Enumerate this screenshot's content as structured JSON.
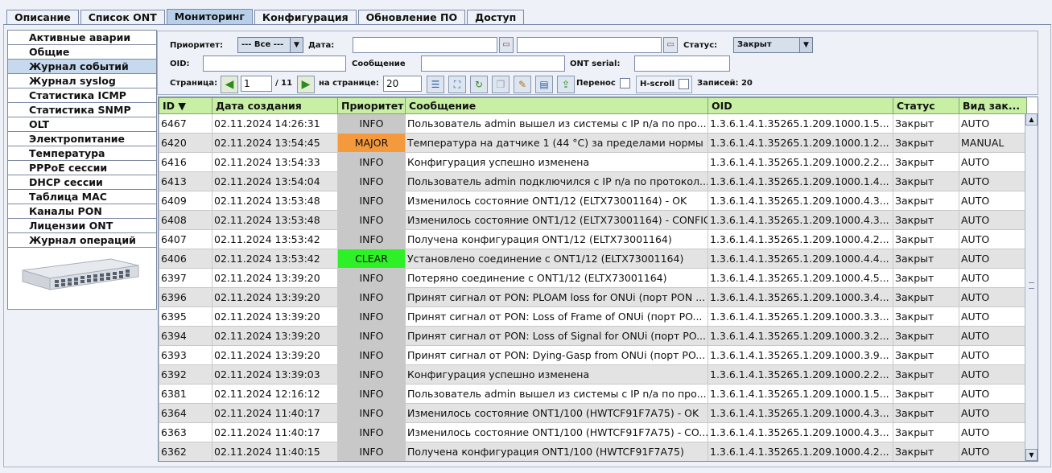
{
  "tabs": [
    "Описание",
    "Список ONT",
    "Мониторинг",
    "Конфигурация",
    "Обновление ПО",
    "Доступ"
  ],
  "sidebar": {
    "items": [
      "Активные аварии",
      "Общие",
      "Журнал событий",
      "Журнал syslog",
      "Статистика ICMP",
      "Статистика SNMP",
      "OLT",
      "Электропитание",
      "Температура",
      "PPPoE сессии",
      "DHCP сессии",
      "Таблица MAC",
      "Каналы PON",
      "Лицензии ONT",
      "Журнал операций"
    ],
    "active": "Журнал событий"
  },
  "filters": {
    "priority_label": "Приоритет:",
    "priority_value": "--- Все ---",
    "date_label": "Дата:",
    "date_from": "",
    "date_to": "",
    "status_label": "Статус:",
    "status_value": "Закрыт",
    "oid_label": "OID:",
    "oid_value": "",
    "message_label": "Сообщение",
    "message_value": "",
    "ont_serial_label": "ONT serial:",
    "ont_serial_value": "",
    "page_label": "Страница:",
    "page_value": "1",
    "page_total": "/ 11",
    "per_page_label": "на странице:",
    "per_page_value": "20",
    "wrap_label": "Перенос",
    "hscroll_label": "H-scroll",
    "records_label": "Записей: 20"
  },
  "table": {
    "headers": [
      "ID ▼",
      "Дата создания",
      "Приоритет",
      "Сообщение",
      "OID",
      "Статус",
      "Вид зак..."
    ],
    "rows": [
      [
        "6467",
        "02.11.2024 14:26:31",
        "INFO",
        "Пользователь admin вышел из системы с IP n/a по про...",
        "1.3.6.1.4.1.35265.1.209.1000.1.5...",
        "Закрыт",
        "AUTO"
      ],
      [
        "6420",
        "02.11.2024 13:54:45",
        "MAJOR",
        "Температура на датчике 1 (44 °C) за пределами нормы",
        "1.3.6.1.4.1.35265.1.209.1000.1.2...",
        "Закрыт",
        "MANUAL"
      ],
      [
        "6416",
        "02.11.2024 13:54:33",
        "INFO",
        "Конфигурация успешно изменена",
        "1.3.6.1.4.1.35265.1.209.1000.2.2...",
        "Закрыт",
        "AUTO"
      ],
      [
        "6413",
        "02.11.2024 13:54:04",
        "INFO",
        "Пользователь admin подключился с IP n/a по протокол...",
        "1.3.6.1.4.1.35265.1.209.1000.1.4...",
        "Закрыт",
        "AUTO"
      ],
      [
        "6409",
        "02.11.2024 13:53:48",
        "INFO",
        "Изменилось состояние ONT1/12 (ELTX73001164) - OK",
        "1.3.6.1.4.1.35265.1.209.1000.4.3...",
        "Закрыт",
        "AUTO"
      ],
      [
        "6408",
        "02.11.2024 13:53:48",
        "INFO",
        "Изменилось состояние ONT1/12 (ELTX73001164) - CONFIG",
        "1.3.6.1.4.1.35265.1.209.1000.4.3...",
        "Закрыт",
        "AUTO"
      ],
      [
        "6407",
        "02.11.2024 13:53:42",
        "INFO",
        "Получена конфигурация ONT1/12 (ELTX73001164)",
        "1.3.6.1.4.1.35265.1.209.1000.4.2...",
        "Закрыт",
        "AUTO"
      ],
      [
        "6406",
        "02.11.2024 13:53:42",
        "CLEAR",
        "Установлено соединение с ONT1/12 (ELTX73001164)",
        "1.3.6.1.4.1.35265.1.209.1000.4.4...",
        "Закрыт",
        "AUTO"
      ],
      [
        "6397",
        "02.11.2024 13:39:20",
        "INFO",
        "Потеряно соединение с ONT1/12 (ELTX73001164)",
        "1.3.6.1.4.1.35265.1.209.1000.4.5...",
        "Закрыт",
        "AUTO"
      ],
      [
        "6396",
        "02.11.2024 13:39:20",
        "INFO",
        "Принят сигнал от PON: PLOAM loss for ONUi (порт PON ...",
        "1.3.6.1.4.1.35265.1.209.1000.3.4...",
        "Закрыт",
        "AUTO"
      ],
      [
        "6395",
        "02.11.2024 13:39:20",
        "INFO",
        "Принят сигнал от PON: Loss of Frame of ONUi (порт PO...",
        "1.3.6.1.4.1.35265.1.209.1000.3.3...",
        "Закрыт",
        "AUTO"
      ],
      [
        "6394",
        "02.11.2024 13:39:20",
        "INFO",
        "Принят сигнал от PON: Loss of Signal for ONUi (порт PO...",
        "1.3.6.1.4.1.35265.1.209.1000.3.2...",
        "Закрыт",
        "AUTO"
      ],
      [
        "6393",
        "02.11.2024 13:39:20",
        "INFO",
        "Принят сигнал от PON: Dying-Gasp from ONUi (порт PO...",
        "1.3.6.1.4.1.35265.1.209.1000.3.9...",
        "Закрыт",
        "AUTO"
      ],
      [
        "6392",
        "02.11.2024 13:39:03",
        "INFO",
        "Конфигурация успешно изменена",
        "1.3.6.1.4.1.35265.1.209.1000.2.2...",
        "Закрыт",
        "AUTO"
      ],
      [
        "6381",
        "02.11.2024 12:16:12",
        "INFO",
        "Пользователь admin вышел из системы с IP n/a по про...",
        "1.3.6.1.4.1.35265.1.209.1000.1.5...",
        "Закрыт",
        "AUTO"
      ],
      [
        "6364",
        "02.11.2024 11:40:17",
        "INFO",
        "Изменилось состояние ONT1/100 (HWTCF91F7A75) - OK",
        "1.3.6.1.4.1.35265.1.209.1000.4.3...",
        "Закрыт",
        "AUTO"
      ],
      [
        "6363",
        "02.11.2024 11:40:17",
        "INFO",
        "Изменилось состояние ONT1/100 (HWTCF91F7A75) - CO...",
        "1.3.6.1.4.1.35265.1.209.1000.4.3...",
        "Закрыт",
        "AUTO"
      ],
      [
        "6362",
        "02.11.2024 11:40:15",
        "INFO",
        "Получена конфигурация ONT1/100 (HWTCF91F7A75)",
        "1.3.6.1.4.1.35265.1.209.1000.4.2...",
        "Закрыт",
        "AUTO"
      ]
    ]
  },
  "colors": {
    "header_bg": "#c7f0a4",
    "info": "#c8c8c8",
    "major": "#f59a3c",
    "clear": "#2ef026",
    "active_tab": "#b8cfe9"
  },
  "icons": [
    "calendar-icon",
    "prev-page-icon",
    "next-page-icon",
    "columns-icon",
    "fit-icon",
    "refresh-icon",
    "copy-icon",
    "clear-filter-icon",
    "save-icon",
    "export-icon"
  ]
}
